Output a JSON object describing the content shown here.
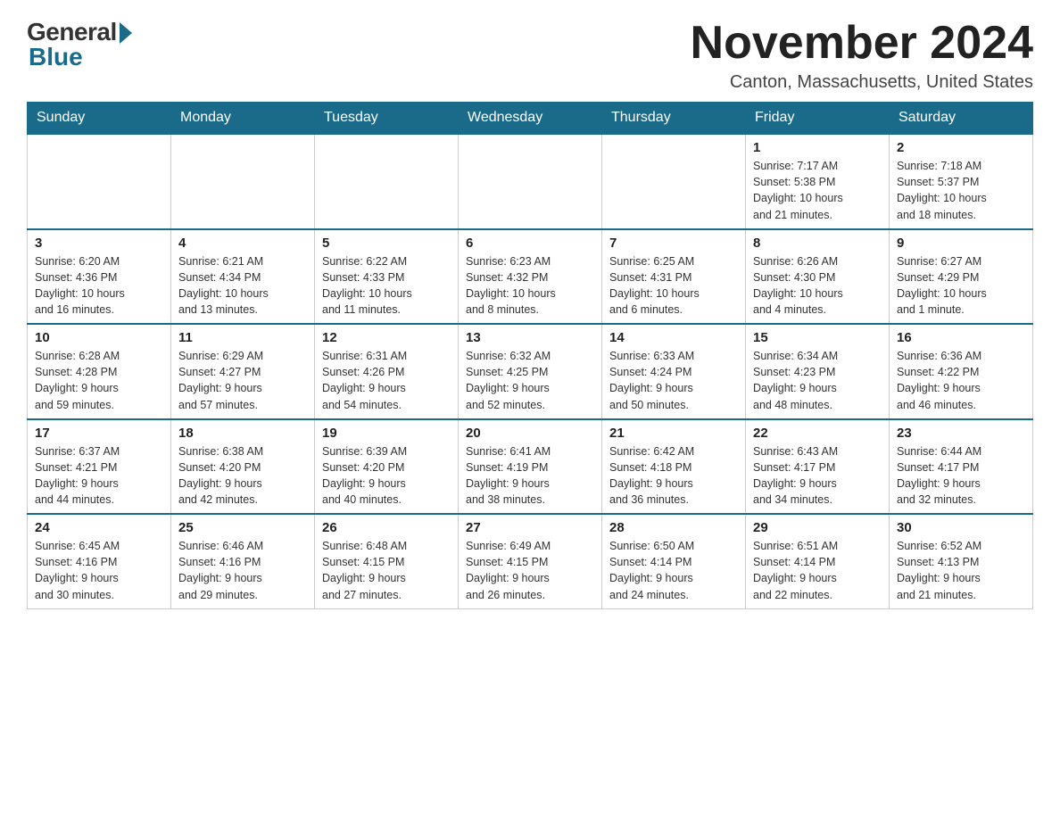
{
  "header": {
    "logo_general": "General",
    "logo_blue": "Blue",
    "month_title": "November 2024",
    "location": "Canton, Massachusetts, United States"
  },
  "days_of_week": [
    "Sunday",
    "Monday",
    "Tuesday",
    "Wednesday",
    "Thursday",
    "Friday",
    "Saturday"
  ],
  "weeks": [
    {
      "days": [
        {
          "num": "",
          "info": ""
        },
        {
          "num": "",
          "info": ""
        },
        {
          "num": "",
          "info": ""
        },
        {
          "num": "",
          "info": ""
        },
        {
          "num": "",
          "info": ""
        },
        {
          "num": "1",
          "info": "Sunrise: 7:17 AM\nSunset: 5:38 PM\nDaylight: 10 hours\nand 21 minutes."
        },
        {
          "num": "2",
          "info": "Sunrise: 7:18 AM\nSunset: 5:37 PM\nDaylight: 10 hours\nand 18 minutes."
        }
      ]
    },
    {
      "days": [
        {
          "num": "3",
          "info": "Sunrise: 6:20 AM\nSunset: 4:36 PM\nDaylight: 10 hours\nand 16 minutes."
        },
        {
          "num": "4",
          "info": "Sunrise: 6:21 AM\nSunset: 4:34 PM\nDaylight: 10 hours\nand 13 minutes."
        },
        {
          "num": "5",
          "info": "Sunrise: 6:22 AM\nSunset: 4:33 PM\nDaylight: 10 hours\nand 11 minutes."
        },
        {
          "num": "6",
          "info": "Sunrise: 6:23 AM\nSunset: 4:32 PM\nDaylight: 10 hours\nand 8 minutes."
        },
        {
          "num": "7",
          "info": "Sunrise: 6:25 AM\nSunset: 4:31 PM\nDaylight: 10 hours\nand 6 minutes."
        },
        {
          "num": "8",
          "info": "Sunrise: 6:26 AM\nSunset: 4:30 PM\nDaylight: 10 hours\nand 4 minutes."
        },
        {
          "num": "9",
          "info": "Sunrise: 6:27 AM\nSunset: 4:29 PM\nDaylight: 10 hours\nand 1 minute."
        }
      ]
    },
    {
      "days": [
        {
          "num": "10",
          "info": "Sunrise: 6:28 AM\nSunset: 4:28 PM\nDaylight: 9 hours\nand 59 minutes."
        },
        {
          "num": "11",
          "info": "Sunrise: 6:29 AM\nSunset: 4:27 PM\nDaylight: 9 hours\nand 57 minutes."
        },
        {
          "num": "12",
          "info": "Sunrise: 6:31 AM\nSunset: 4:26 PM\nDaylight: 9 hours\nand 54 minutes."
        },
        {
          "num": "13",
          "info": "Sunrise: 6:32 AM\nSunset: 4:25 PM\nDaylight: 9 hours\nand 52 minutes."
        },
        {
          "num": "14",
          "info": "Sunrise: 6:33 AM\nSunset: 4:24 PM\nDaylight: 9 hours\nand 50 minutes."
        },
        {
          "num": "15",
          "info": "Sunrise: 6:34 AM\nSunset: 4:23 PM\nDaylight: 9 hours\nand 48 minutes."
        },
        {
          "num": "16",
          "info": "Sunrise: 6:36 AM\nSunset: 4:22 PM\nDaylight: 9 hours\nand 46 minutes."
        }
      ]
    },
    {
      "days": [
        {
          "num": "17",
          "info": "Sunrise: 6:37 AM\nSunset: 4:21 PM\nDaylight: 9 hours\nand 44 minutes."
        },
        {
          "num": "18",
          "info": "Sunrise: 6:38 AM\nSunset: 4:20 PM\nDaylight: 9 hours\nand 42 minutes."
        },
        {
          "num": "19",
          "info": "Sunrise: 6:39 AM\nSunset: 4:20 PM\nDaylight: 9 hours\nand 40 minutes."
        },
        {
          "num": "20",
          "info": "Sunrise: 6:41 AM\nSunset: 4:19 PM\nDaylight: 9 hours\nand 38 minutes."
        },
        {
          "num": "21",
          "info": "Sunrise: 6:42 AM\nSunset: 4:18 PM\nDaylight: 9 hours\nand 36 minutes."
        },
        {
          "num": "22",
          "info": "Sunrise: 6:43 AM\nSunset: 4:17 PM\nDaylight: 9 hours\nand 34 minutes."
        },
        {
          "num": "23",
          "info": "Sunrise: 6:44 AM\nSunset: 4:17 PM\nDaylight: 9 hours\nand 32 minutes."
        }
      ]
    },
    {
      "days": [
        {
          "num": "24",
          "info": "Sunrise: 6:45 AM\nSunset: 4:16 PM\nDaylight: 9 hours\nand 30 minutes."
        },
        {
          "num": "25",
          "info": "Sunrise: 6:46 AM\nSunset: 4:16 PM\nDaylight: 9 hours\nand 29 minutes."
        },
        {
          "num": "26",
          "info": "Sunrise: 6:48 AM\nSunset: 4:15 PM\nDaylight: 9 hours\nand 27 minutes."
        },
        {
          "num": "27",
          "info": "Sunrise: 6:49 AM\nSunset: 4:15 PM\nDaylight: 9 hours\nand 26 minutes."
        },
        {
          "num": "28",
          "info": "Sunrise: 6:50 AM\nSunset: 4:14 PM\nDaylight: 9 hours\nand 24 minutes."
        },
        {
          "num": "29",
          "info": "Sunrise: 6:51 AM\nSunset: 4:14 PM\nDaylight: 9 hours\nand 22 minutes."
        },
        {
          "num": "30",
          "info": "Sunrise: 6:52 AM\nSunset: 4:13 PM\nDaylight: 9 hours\nand 21 minutes."
        }
      ]
    }
  ]
}
